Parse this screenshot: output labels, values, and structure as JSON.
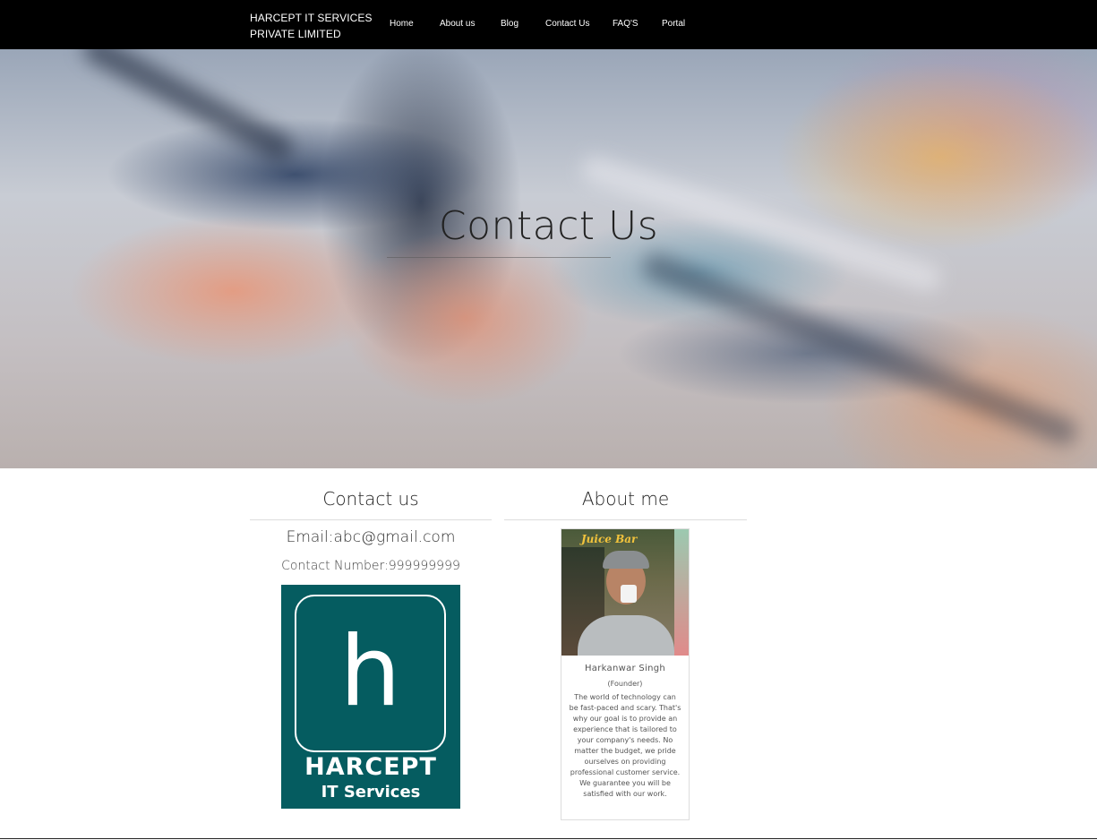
{
  "brand": {
    "name_line1": "HARCEPT IT SERVICES",
    "name_line2": "PRIVATE LIMITED"
  },
  "nav": {
    "items": [
      {
        "label": "Home"
      },
      {
        "label": "About us"
      },
      {
        "label": "Blog"
      },
      {
        "label": "Contact Us"
      },
      {
        "label": "FAQ'S"
      },
      {
        "label": "Portal"
      }
    ]
  },
  "hero": {
    "title": "Contact Us"
  },
  "contact": {
    "heading": "Contact us",
    "email": "Email:abc@gmail.com",
    "phone": "Contact Number:999999999",
    "logo": {
      "letter": "h",
      "name": "HARCEPT",
      "sub": "IT Services",
      "color": "#055c60"
    }
  },
  "about": {
    "heading": "About me",
    "photo_sign": "Juice Bar",
    "name": "Harkanwar Singh",
    "role": "(Founder)",
    "bio": "The world of technology can be fast-paced and scary. That's why our goal is to provide an experience that is tailored to your company's needs. No matter the budget, we pride ourselves on providing professional customer service. We guarantee you will be satisfied with our work."
  },
  "colors": {
    "nav_bg": "#000000",
    "logo_teal": "#055c60",
    "text": "#222222"
  }
}
